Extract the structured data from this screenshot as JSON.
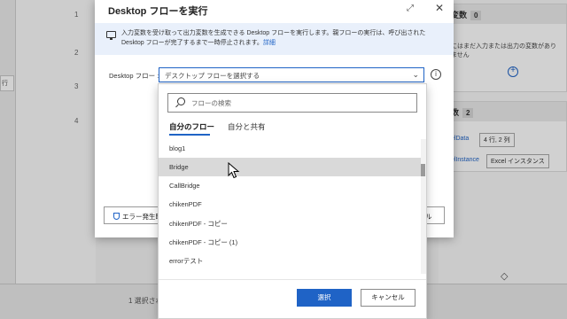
{
  "background": {
    "left_tab": "行",
    "line_numbers": [
      "1",
      "2",
      "3",
      "4"
    ],
    "vars_input": {
      "title": "変数",
      "count": "0",
      "hint": "にはまだ入力または出力の変数がありません"
    },
    "vars_flow": {
      "title": "数",
      "count": "2",
      "rows": [
        {
          "name": "elData",
          "value": "4 行, 2 列"
        },
        {
          "name": "elInstance",
          "value": "Excel インスタンス"
        }
      ]
    },
    "status_text": "1 選択され"
  },
  "dialog": {
    "title": "Desktop フローを実行",
    "info_line1": "入力変数を受け取って出力変数を生成できる Desktop フローを実行します。親フローの実行は、呼び出された",
    "info_line2": "Desktop フローが完了するまで一時停止されます。",
    "info_link": "詳細",
    "field_label": "Desktop フロー :",
    "combo_placeholder": "デスクトップ フローを選択する",
    "error_button": "エラー発生時",
    "cancel_button_partial": "ル"
  },
  "popup": {
    "search_placeholder": "フローの検索",
    "tabs": [
      {
        "label": "自分のフロー",
        "active": true
      },
      {
        "label": "自分と共有",
        "active": false
      }
    ],
    "flows": [
      "blog1",
      "Bridge",
      "CallBridge",
      "chikenPDF",
      "chikenPDF - コピー",
      "chikenPDF - コピー (1)",
      "errorテスト"
    ],
    "selected_index": 1,
    "select_button": "選択",
    "cancel_button": "キャンセル"
  }
}
